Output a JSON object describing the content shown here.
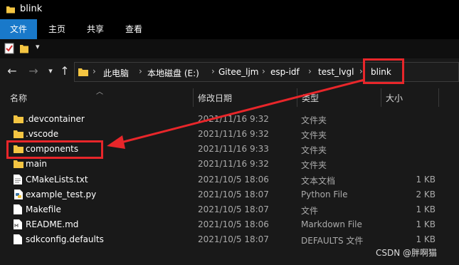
{
  "window": {
    "title": "blink"
  },
  "ribbon": {
    "tabs": [
      "文件",
      "主页",
      "共享",
      "查看"
    ]
  },
  "address": {
    "crumbs": [
      "此电脑",
      "本地磁盘 (E:)",
      "Gitee_ljm",
      "esp-idf",
      "test_lvgl",
      "blink"
    ]
  },
  "columns": {
    "name": "名称",
    "date": "修改日期",
    "type": "类型",
    "size": "大小"
  },
  "files": [
    {
      "name": ".devcontainer",
      "date": "2021/11/16 9:32",
      "type": "文件夹",
      "size": "",
      "icon": "folder-icon"
    },
    {
      "name": ".vscode",
      "date": "2021/11/16 9:32",
      "type": "文件夹",
      "size": "",
      "icon": "folder-icon"
    },
    {
      "name": "components",
      "date": "2021/11/16 9:33",
      "type": "文件夹",
      "size": "",
      "icon": "folder-icon"
    },
    {
      "name": "main",
      "date": "2021/11/16 9:32",
      "type": "文件夹",
      "size": "",
      "icon": "folder-icon"
    },
    {
      "name": "CMakeLists.txt",
      "date": "2021/10/5 18:06",
      "type": "文本文档",
      "size": "1 KB",
      "icon": "text-file-icon"
    },
    {
      "name": "example_test.py",
      "date": "2021/10/5 18:07",
      "type": "Python File",
      "size": "2 KB",
      "icon": "python-file-icon"
    },
    {
      "name": "Makefile",
      "date": "2021/10/5 18:07",
      "type": "文件",
      "size": "1 KB",
      "icon": "file-icon"
    },
    {
      "name": "README.md",
      "date": "2021/10/5 18:06",
      "type": "Markdown File",
      "size": "1 KB",
      "icon": "markdown-file-icon"
    },
    {
      "name": "sdkconfig.defaults",
      "date": "2021/10/5 18:07",
      "type": "DEFAULTS 文件",
      "size": "1 KB",
      "icon": "file-icon"
    }
  ],
  "watermark": "CSDN @胖啊猫",
  "colors": {
    "accent": "#1979ca",
    "annotation": "#e8262a",
    "folder": "#f4c542"
  }
}
